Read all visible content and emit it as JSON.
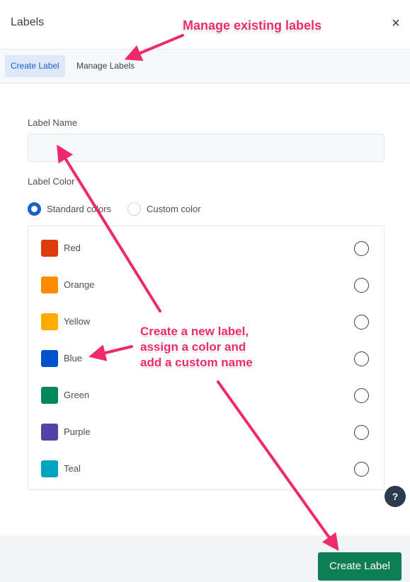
{
  "header": {
    "title": "Labels",
    "close_label": "×"
  },
  "tabs": [
    {
      "label": "Create Label",
      "active": true
    },
    {
      "label": "Manage Labels",
      "active": false
    }
  ],
  "form": {
    "name_label": "Label Name",
    "name_value": "",
    "name_placeholder": "",
    "color_label": "Label Color",
    "color_modes": [
      {
        "label": "Standard colors",
        "selected": true
      },
      {
        "label": "Custom color",
        "selected": false
      }
    ],
    "colors": [
      {
        "name": "Red",
        "hex": "#dd3b0f",
        "selected": false
      },
      {
        "name": "Orange",
        "hex": "#ff8b00",
        "selected": false
      },
      {
        "name": "Yellow",
        "hex": "#ffab00",
        "selected": false
      },
      {
        "name": "Blue",
        "hex": "#0052cc",
        "selected": false
      },
      {
        "name": "Green",
        "hex": "#00875a",
        "selected": false
      },
      {
        "name": "Purple",
        "hex": "#5243aa",
        "selected": false
      },
      {
        "name": "Teal",
        "hex": "#00a3bf",
        "selected": false
      }
    ]
  },
  "help": {
    "label": "?"
  },
  "footer": {
    "create_label": "Create Label"
  },
  "annotations": {
    "top": "Manage existing labels",
    "middle": [
      "Create a new label,",
      "assign a color and",
      "add a custom name"
    ],
    "color": "#ee2a6a"
  }
}
